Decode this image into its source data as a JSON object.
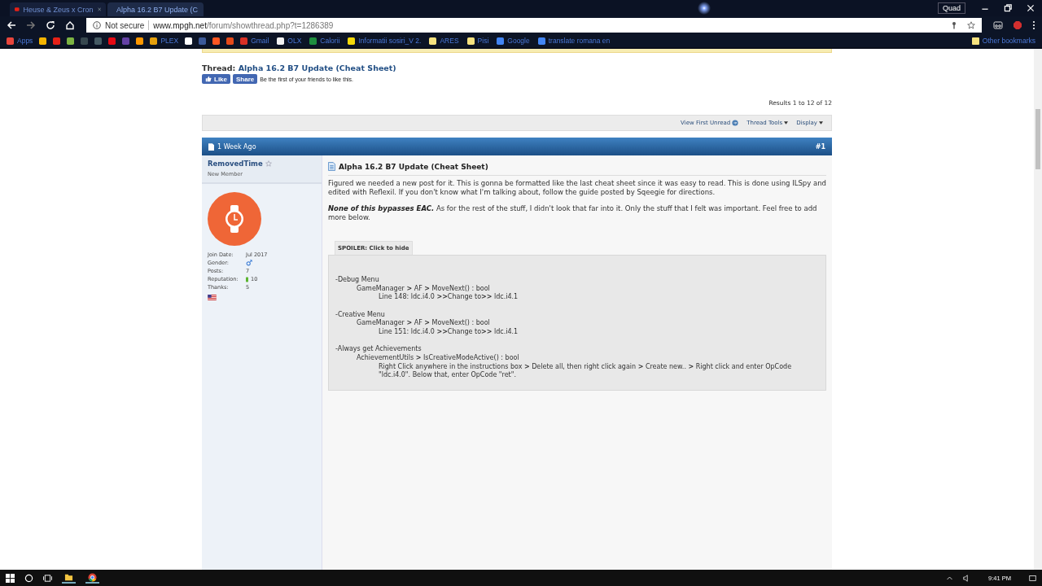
{
  "browser": {
    "tabs": [
      {
        "title": "Heuse & Zeus x Cron",
        "selected": false
      },
      {
        "title": "Alpha 16.2 B7 Update (C",
        "selected": true
      }
    ],
    "profile": "Quad",
    "address": {
      "security": "Not secure",
      "host": "www.mpgh.net",
      "path": "/forum/showthread.php?t=1286389"
    },
    "bookmarks": [
      {
        "label": "Apps",
        "color": "#e8453c"
      },
      {
        "label": "PLEX",
        "color": "#e5a00d"
      },
      {
        "label": "Gmail",
        "color": "#d93025"
      },
      {
        "label": "OLX",
        "color": "#f2f2f2"
      },
      {
        "label": "Calorii",
        "color": "#1e8e3e"
      },
      {
        "label": "Informatii sosiri_V 2.",
        "color": "#f5d90a"
      },
      {
        "label": "ARES",
        "color": "#f6e27f"
      },
      {
        "label": "Pisi",
        "color": "#f6e27f"
      },
      {
        "label": "Google",
        "color": "#4285f4"
      },
      {
        "label": "translate romana en",
        "color": "#4285f4"
      }
    ],
    "other_bookmarks": "Other bookmarks"
  },
  "thread": {
    "prefix": "Thread:",
    "title": "Alpha 16.2 B7 Update (Cheat Sheet)",
    "like": "Like",
    "share": "Share",
    "social_text": "Be the first of your friends to like this.",
    "results": "Results 1 to 12 of 12",
    "tools": [
      "View First Unread",
      "Thread Tools",
      "Display"
    ]
  },
  "post": {
    "date": "1 Week Ago",
    "number": "#1",
    "user": {
      "name": "RemovedTime",
      "rank": "New Member",
      "stats": [
        {
          "label": "Join Date:",
          "value": "Jul 2017",
          "kind": "text"
        },
        {
          "label": "Gender:",
          "kind": "gender"
        },
        {
          "label": "Posts:",
          "value": "7",
          "kind": "text"
        },
        {
          "label": "Reputation:",
          "value": "10",
          "kind": "reputation"
        },
        {
          "label": "Thanks:",
          "value": "5",
          "kind": "text"
        }
      ]
    },
    "title": "Alpha 16.2 B7 Update (Cheat Sheet)",
    "paragraphs": [
      "Figured we needed a new post for it. This is gonna be formatted like the last cheat sheet since it was easy to read. This is done using ILSpy and edited with Reflexil. If you don't know what I'm talking about, follow the guide posted by Sqeegie for directions.",
      "**None of this bypasses EAC.** As for the rest of the stuff, I didn't look that far into it. Only the stuff that I felt was important. Feel free to add more below."
    ],
    "spoiler": {
      "label": "SPOILER: Click to hide",
      "sections": [
        {
          "text": "-Debug Menu",
          "children": [
            {
              "text": "GameManager **>** AF **>** MoveNext() : bool",
              "children": [
                {
                  "text": "Line 148: ldc.i4.0 **>>**Change to**>>** ldc.i4.1"
                }
              ]
            }
          ]
        },
        {
          "text": "-Creative Menu",
          "children": [
            {
              "text": "GameManager **>** AF **>** MoveNext() : bool",
              "children": [
                {
                  "text": "Line 151: ldc.i4.0 **>>**Change to**>>** ldc.i4.1"
                }
              ]
            }
          ]
        },
        {
          "text": "-Always get Achievements",
          "children": [
            {
              "text": "AchievementUtils **>** IsCreativeModeActive() : bool",
              "children": [
                {
                  "text": "Right Click anywhere in the instructions box **>** Delete all, then right click again **>** Create new.. **>** Right click and enter OpCode \"ldc.i4.0\". Below that, enter OpCode \"ret\"."
                }
              ]
            }
          ]
        }
      ]
    }
  },
  "taskbar": {
    "time": "9:41 PM"
  }
}
